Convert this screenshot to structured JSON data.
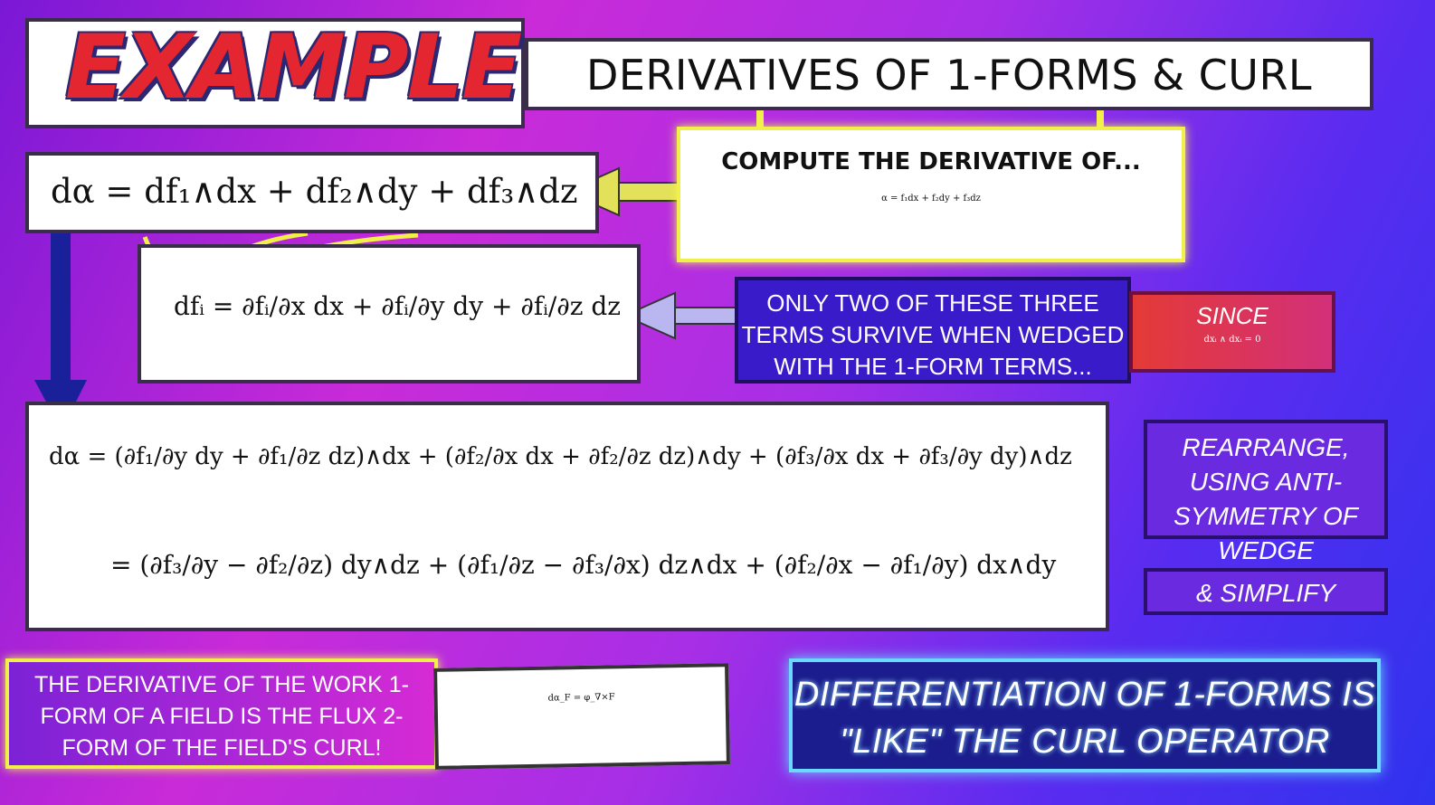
{
  "header": {
    "example": "EXAMPLE",
    "title": "DERIVATIVES OF 1-FORMS & CURL"
  },
  "compute": {
    "label": "COMPUTE THE DERIVATIVE OF...",
    "equation": "α = f₁dx + f₂dy + f₃dz"
  },
  "dalpha": {
    "equation": "dα = df₁∧dx + df₂∧dy + df₃∧dz"
  },
  "dfi": {
    "equation": "dfᵢ = ∂fᵢ/∂x dx + ∂fᵢ/∂y dy + ∂fᵢ/∂z dz"
  },
  "two_terms": {
    "text": "ONLY TWO OF THESE THREE TERMS SURVIVE WHEN WEDGED WITH THE 1-FORM TERMS..."
  },
  "since": {
    "label": "SINCE",
    "equation": "dxᵢ ∧ dxᵢ = 0"
  },
  "expansion": {
    "line1": "dα = (∂f₁/∂y dy + ∂f₁/∂z dz)∧dx + (∂f₂/∂x dx + ∂f₂/∂z dz)∧dy + (∂f₃/∂x dx + ∂f₃/∂y dy)∧dz",
    "line2": "= (∂f₃/∂y − ∂f₂/∂z) dy∧dz + (∂f₁/∂z − ∂f₃/∂x) dz∧dx + (∂f₂/∂x − ∂f₁/∂y) dx∧dy"
  },
  "rearrange": {
    "text": "REARRANGE, USING ANTI-SYMMETRY OF WEDGE"
  },
  "simplify": {
    "text": "& SIMPLIFY"
  },
  "flux": {
    "text": "THE DERIVATIVE OF THE WORK 1-FORM OF A FIELD IS THE FLUX 2-FORM OF THE FIELD'S CURL!"
  },
  "result": {
    "equation": "dα_F = φ_∇×F"
  },
  "conclusion": {
    "text": "DIFFERENTIATION OF 1-FORMS IS \"LIKE\" THE CURL OPERATOR"
  },
  "colors": {
    "yellow_arrow": "#f1f04a",
    "lavender_arrow": "#b9b6f0",
    "blue_arrow": "#1a1f9a"
  }
}
